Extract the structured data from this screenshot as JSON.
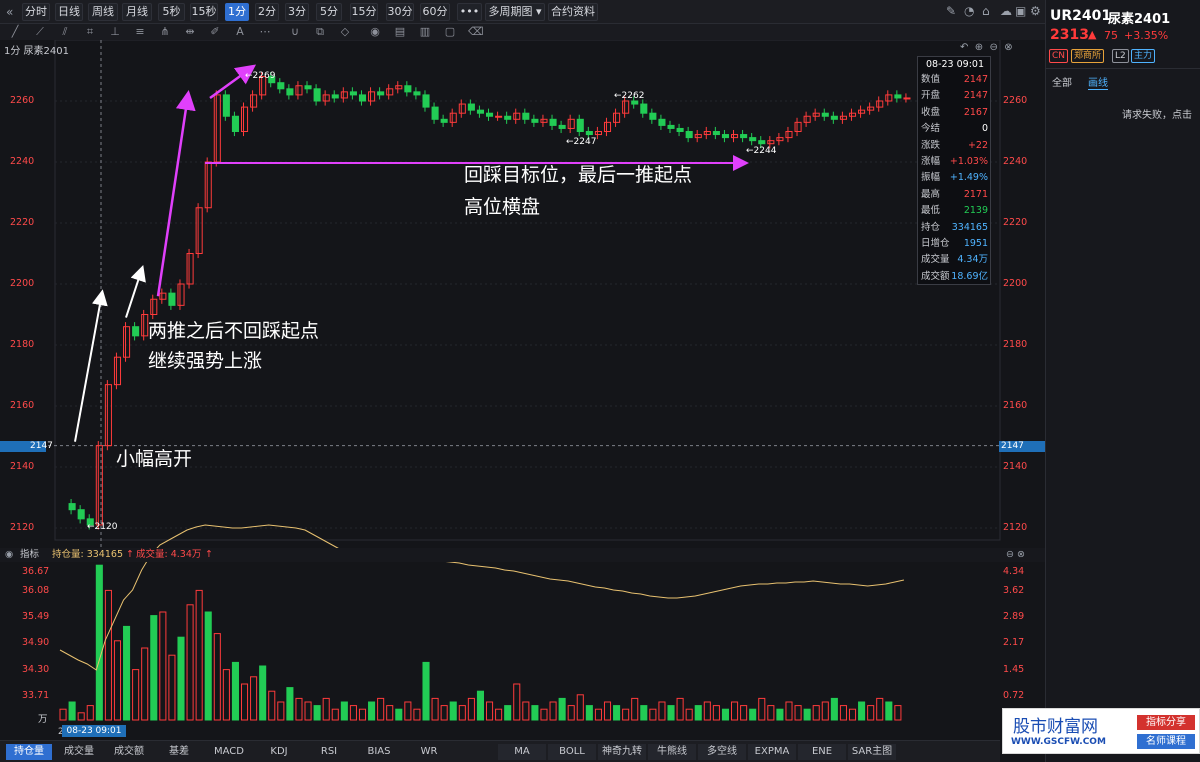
{
  "toolbar": {
    "periods": [
      "分时",
      "日线",
      "周线",
      "月线",
      "5秒",
      "15秒",
      "1分",
      "2分",
      "3分",
      "5分",
      "15分",
      "30分",
      "60分"
    ],
    "active_period": "1分",
    "more_label": "•••",
    "multi_period_label": "多周期图",
    "contract_info_label": "合约资料",
    "icons": [
      "collapse-icon",
      "edit-icon",
      "bell-icon",
      "screenshot-icon",
      "cloud-icon",
      "camera-icon",
      "settings-icon",
      "layout-icon"
    ]
  },
  "drawbar": {
    "icons": [
      "line-icon",
      "ray-icon",
      "parallel-icon",
      "horizontal-icon",
      "crop-icon",
      "fib-icon",
      "fork-icon",
      "channel-icon",
      "pen-icon",
      "text-icon",
      "more-icon",
      "magnet-icon",
      "copy-icon",
      "eraser-icon",
      "eye-icon",
      "lock-icon",
      "trash-icon",
      "note-icon",
      "delete-icon"
    ]
  },
  "chart": {
    "header": "1分 尿素2401",
    "y_ticks": [
      "2260",
      "2240",
      "2220",
      "2200",
      "2180",
      "2160",
      "2140",
      "2120"
    ],
    "current_price": "2147",
    "marks": {
      "low": "←2120",
      "high": "←2269",
      "mid_high": "←2262",
      "mid_low": "←2247",
      "late_low": "←2244"
    }
  },
  "info": {
    "time": "08-23 09:01",
    "rows": [
      {
        "k": "数值",
        "v": "2147",
        "c": "#ff4a4a"
      },
      {
        "k": "开盘",
        "v": "2147",
        "c": "#ff4a4a"
      },
      {
        "k": "收盘",
        "v": "2167",
        "c": "#ff4a4a"
      },
      {
        "k": "今结",
        "v": "0",
        "c": "#ffffff"
      },
      {
        "k": "涨跌",
        "v": "+22",
        "c": "#ff4a4a"
      },
      {
        "k": "涨幅",
        "v": "+1.03%",
        "c": "#ff4a4a"
      },
      {
        "k": "振幅",
        "v": "+1.49%",
        "c": "#4fb3ff"
      },
      {
        "k": "最高",
        "v": "2171",
        "c": "#ff4a4a"
      },
      {
        "k": "最低",
        "v": "2139",
        "c": "#22cc55"
      },
      {
        "k": "持仓",
        "v": "334165",
        "c": "#4fb3ff"
      },
      {
        "k": "日增仓",
        "v": "1951",
        "c": "#4fb3ff"
      },
      {
        "k": "成交量",
        "v": "4.34万",
        "c": "#4fb3ff"
      },
      {
        "k": "成交额",
        "v": "18.69亿",
        "c": "#4fb3ff"
      }
    ]
  },
  "annotations": {
    "a1": "回踩目标位，最后一推起点",
    "a2": "高位横盘",
    "a3": "两推之后不回踩起点",
    "a4": "继续强势上涨",
    "a5": "小幅高开"
  },
  "indicator": {
    "label": "指标",
    "oi_label": "持仓量: 334165",
    "vol_label": "成交量: 4.34万",
    "left_ticks": [
      "36.67",
      "36.08",
      "35.49",
      "34.90",
      "34.30",
      "33.71",
      "万"
    ],
    "right_ticks": [
      "4.34",
      "3.62",
      "2.89",
      "2.17",
      "1.45",
      "0.72"
    ],
    "year_label": "2023",
    "time_label": "08-23 09:01"
  },
  "bottom_tabs": [
    "持仓量",
    "成交量",
    "成交额",
    "基差",
    "MACD",
    "KDJ",
    "RSI",
    "BIAS",
    "WR"
  ],
  "bottom_tabs2": [
    "MA",
    "BOLL",
    "神奇九转",
    "牛熊线",
    "多空线",
    "EXPMA",
    "ENE",
    "SAR主图"
  ],
  "active_bottom_tab": "持仓量",
  "right_panel": {
    "code": "UR2401",
    "name": "尿素2401",
    "price": "2313",
    "change": "75",
    "change_pct": "+3.35%",
    "badges": [
      "CN",
      "郑商所",
      "L2",
      "主力"
    ],
    "tabs": [
      "全部",
      "画线"
    ],
    "active_tab": "画线",
    "message": "请求失败，点击"
  },
  "watermark": {
    "title": "股市财富网",
    "url": "WWW.GSCFW.COM",
    "tag1": "指标分享",
    "tag2": "名师课程"
  },
  "colors": {
    "up": "#ff3b3b",
    "down": "#22cc55",
    "accent": "#2f6fd1",
    "magenta": "#e040fb"
  }
}
